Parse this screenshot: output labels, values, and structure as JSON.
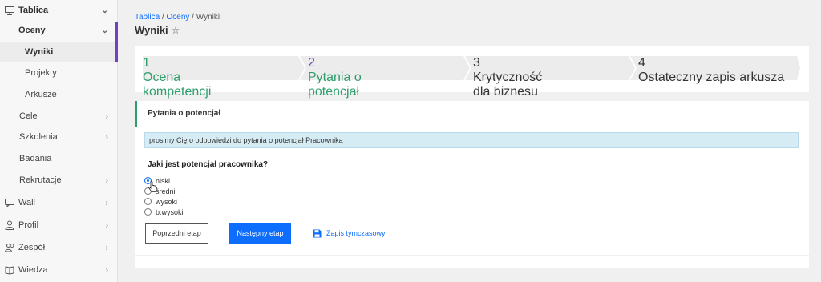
{
  "sidebar": {
    "items": [
      {
        "label": "Tablica",
        "icon": "monitor-icon"
      },
      {
        "label": "Oceny"
      },
      {
        "label": "Wyniki"
      },
      {
        "label": "Projekty"
      },
      {
        "label": "Arkusze"
      },
      {
        "label": "Cele"
      },
      {
        "label": "Szkolenia"
      },
      {
        "label": "Badania"
      },
      {
        "label": "Rekrutacje"
      },
      {
        "label": "Wall",
        "icon": "chat-icon"
      },
      {
        "label": "Profil",
        "icon": "user-icon"
      },
      {
        "label": "Zespół",
        "icon": "team-icon"
      },
      {
        "label": "Wiedza",
        "icon": "book-icon"
      }
    ]
  },
  "breadcrumb": {
    "part1": "Tablica",
    "sep1": " / ",
    "part2": "Oceny",
    "sep2": " / ",
    "part3": "Wyniki"
  },
  "page": {
    "title": "Wyniki",
    "star": "☆"
  },
  "stepper": [
    {
      "num": "1",
      "line1": "Ocena",
      "line2": "kompetencji",
      "state": "done"
    },
    {
      "num": "2",
      "line1": "Pytania o",
      "line2": "potencjał",
      "state": "current"
    },
    {
      "num": "3",
      "line1": "Krytyczność",
      "line2": "dla biznesu",
      "state": "todo"
    },
    {
      "num": "4",
      "line1": "Ostateczny zapis arkusza",
      "line2": "",
      "state": "todo"
    }
  ],
  "section": {
    "title": "Pytania o potencjał",
    "info": "prosimy Cię o odpowiedzi do pytania o potencjał Pracownika",
    "question": "Jaki jest potencjał pracownika?",
    "options": [
      "niski",
      "średni",
      "wysoki",
      "b.wysoki"
    ],
    "selected": 0
  },
  "buttons": {
    "prev": "Poprzedni etap",
    "next": "Następny etap",
    "save": "Zapis tymczasowy"
  },
  "colors": {
    "accent": "#0d6efd",
    "done": "#2e9e6b",
    "current": "#6f42c1",
    "info_bg": "#d6ecf5"
  }
}
